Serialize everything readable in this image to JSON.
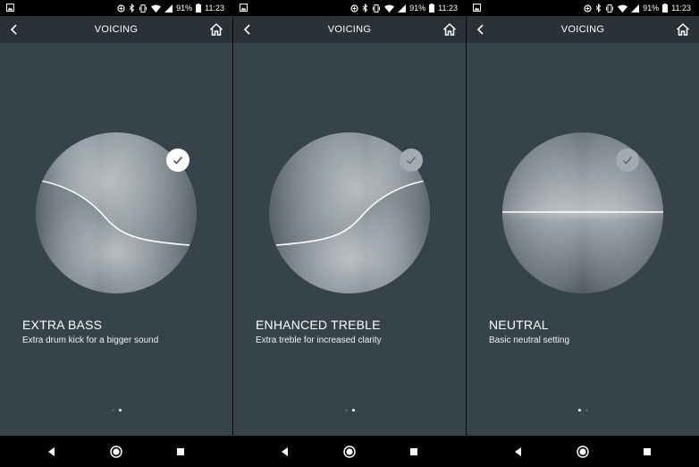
{
  "status_bar": {
    "battery": "91%",
    "time": "11:23"
  },
  "screens": [
    {
      "title": "VOICING",
      "voicing": {
        "name": "EXTRA BASS",
        "description": "Extra drum kick for a bigger sound",
        "selected": true,
        "curve": "bass"
      },
      "page_indicator": {
        "count": 2,
        "active": 1
      }
    },
    {
      "title": "VOICING",
      "voicing": {
        "name": "ENHANCED TREBLE",
        "description": "Extra treble for increased clarity",
        "selected": false,
        "curve": "treble"
      },
      "page_indicator": {
        "count": 2,
        "active": 1
      }
    },
    {
      "title": "VOICING",
      "voicing": {
        "name": "NEUTRAL",
        "description": "Basic neutral setting",
        "selected": false,
        "curve": "neutral"
      },
      "page_indicator": {
        "count": 2,
        "active": 0
      }
    }
  ],
  "icons": {
    "status": [
      "gallery-icon",
      "data-saver-icon",
      "bluetooth-icon",
      "vibrate-icon",
      "wifi-icon",
      "signal-icon",
      "battery-icon"
    ],
    "appbar": [
      "back-arrow-icon",
      "home-icon"
    ],
    "navigation": [
      "nav-back-icon",
      "nav-home-icon",
      "nav-recents-icon"
    ]
  },
  "colors": {
    "background": "#36434b",
    "appbar": "#2a3238",
    "selected_check": "#ffffff",
    "unselected_check": "#a4abaf"
  }
}
